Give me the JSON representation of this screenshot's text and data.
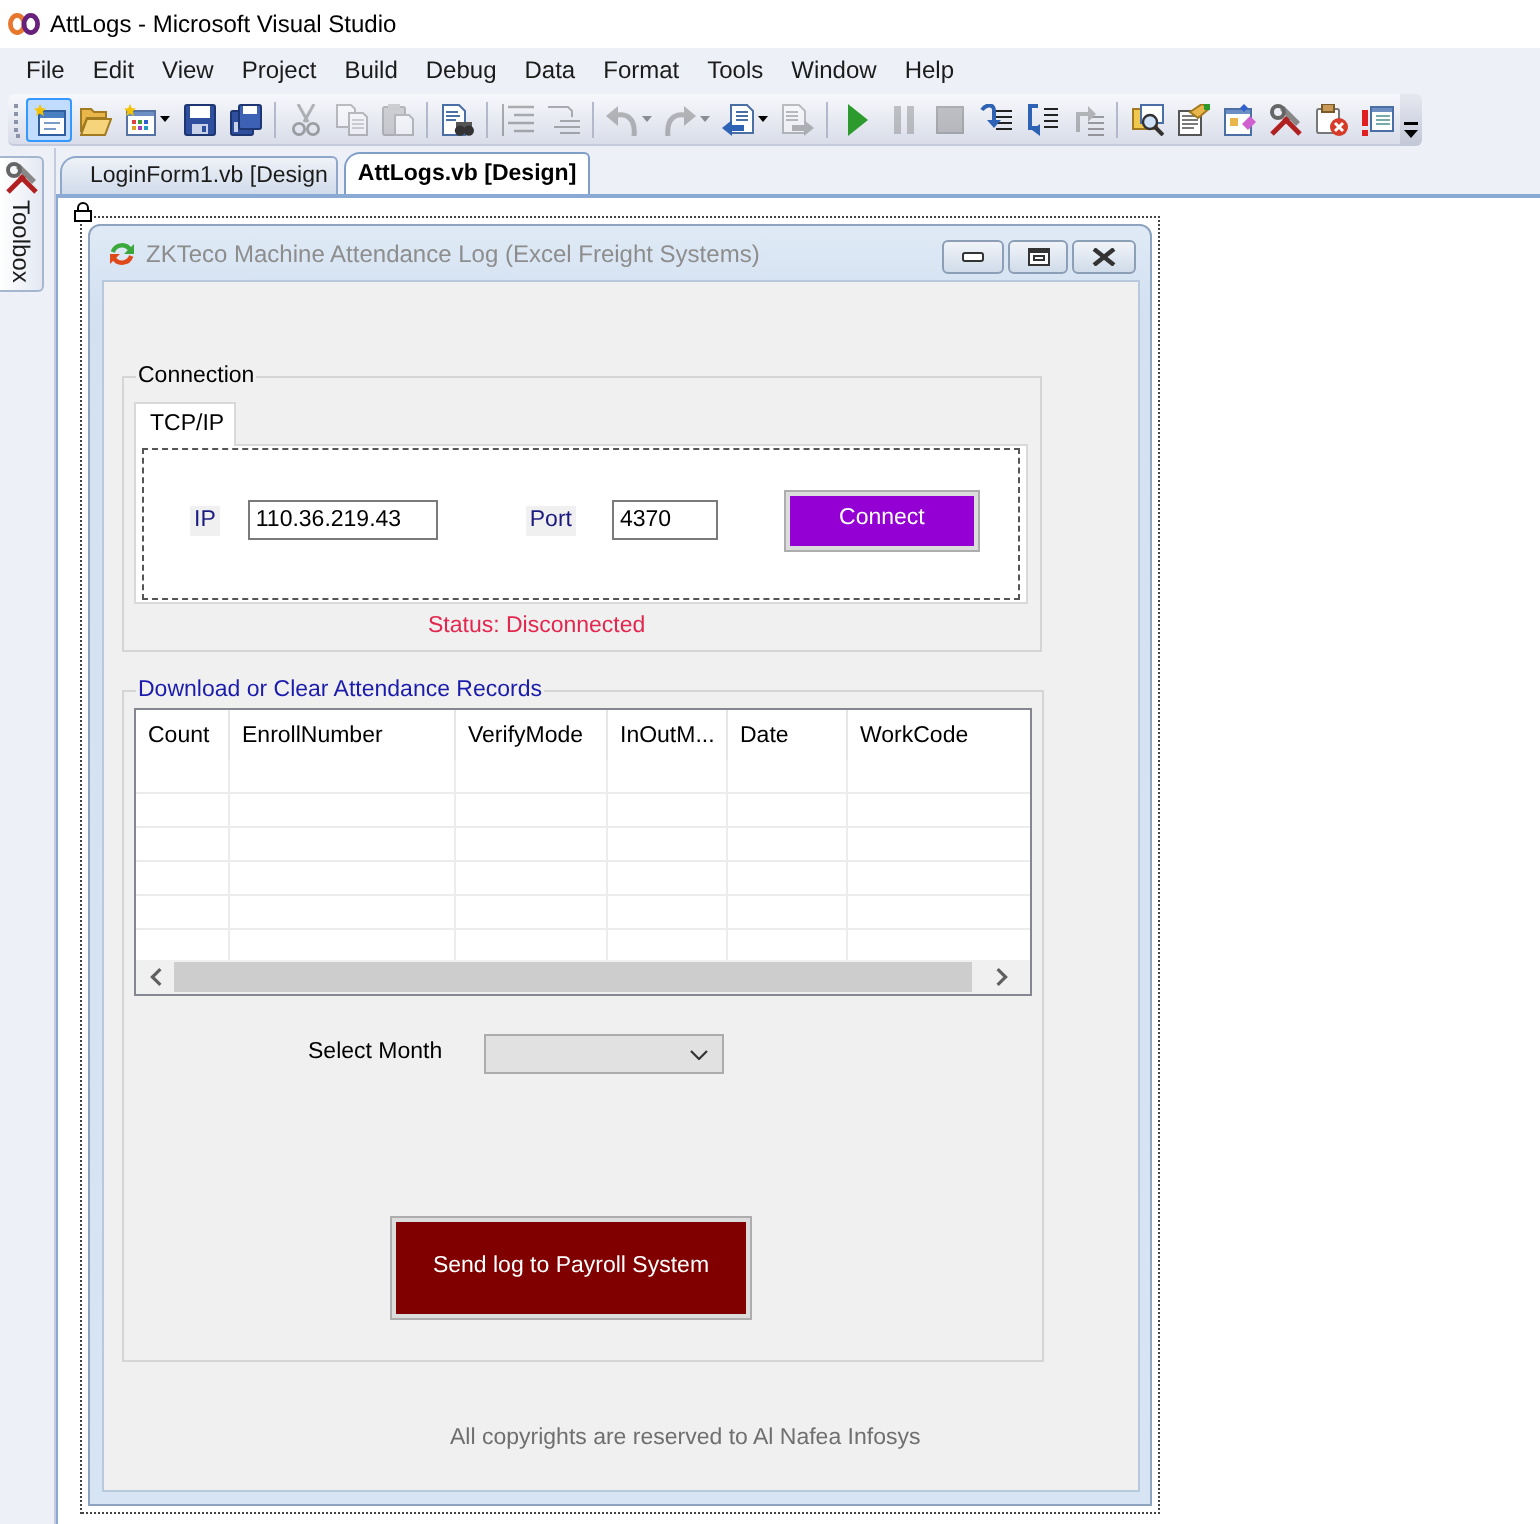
{
  "window": {
    "title": "AttLogs - Microsoft Visual Studio"
  },
  "menu": [
    "File",
    "Edit",
    "View",
    "Project",
    "Build",
    "Debug",
    "Data",
    "Format",
    "Tools",
    "Window",
    "Help"
  ],
  "toolbar": [
    [
      {
        "disabled": false,
        "highlighted": true,
        "dropdown": false
      },
      {
        "disabled": false,
        "highlighted": false,
        "dropdown": false
      },
      {
        "disabled": false,
        "highlighted": false,
        "dropdown": true
      },
      {
        "disabled": false,
        "highlighted": false,
        "dropdown": false
      },
      {
        "disabled": false,
        "highlighted": false,
        "dropdown": false
      }
    ],
    [
      {
        "disabled": true,
        "highlighted": false,
        "dropdown": false
      },
      {
        "disabled": true,
        "highlighted": false,
        "dropdown": false
      },
      {
        "disabled": true,
        "highlighted": false,
        "dropdown": false
      }
    ],
    [
      {
        "disabled": false,
        "highlighted": false,
        "dropdown": false
      }
    ],
    [
      {
        "disabled": true,
        "highlighted": false,
        "dropdown": false
      },
      {
        "disabled": true,
        "highlighted": false,
        "dropdown": false
      }
    ],
    [
      {
        "disabled": true,
        "highlighted": false,
        "dropdown": true
      },
      {
        "disabled": true,
        "highlighted": false,
        "dropdown": true
      },
      {
        "disabled": false,
        "highlighted": false,
        "dropdown": true
      },
      {
        "disabled": true,
        "highlighted": false,
        "dropdown": false
      }
    ],
    [
      {
        "disabled": false,
        "highlighted": false,
        "dropdown": false
      },
      {
        "disabled": true,
        "highlighted": false,
        "dropdown": false
      },
      {
        "disabled": true,
        "highlighted": false,
        "dropdown": false
      },
      {
        "disabled": false,
        "highlighted": false,
        "dropdown": false
      },
      {
        "disabled": false,
        "highlighted": false,
        "dropdown": false
      },
      {
        "disabled": true,
        "highlighted": false,
        "dropdown": false
      }
    ],
    [
      {
        "disabled": false,
        "highlighted": false,
        "dropdown": false
      },
      {
        "disabled": false,
        "highlighted": false,
        "dropdown": false
      },
      {
        "disabled": false,
        "highlighted": false,
        "dropdown": false
      },
      {
        "disabled": false,
        "highlighted": false,
        "dropdown": false
      },
      {
        "disabled": false,
        "highlighted": false,
        "dropdown": false
      },
      {
        "disabled": false,
        "highlighted": false,
        "dropdown": false
      }
    ]
  ],
  "toolbox": {
    "label": "Toolbox"
  },
  "tabs": [
    {
      "label": "LoginForm1.vb [Design",
      "selected": false
    },
    {
      "label": "AttLogs.vb [Design]",
      "selected": true
    }
  ],
  "form": {
    "title": "ZKTeco Machine Attendance Log (Excel Freight Systems)",
    "connection": {
      "legend": "Connection",
      "tabs": [
        {
          "label": "TCP/IP",
          "selected": true
        }
      ],
      "ip_label": "IP",
      "ip": "110.36.219.43",
      "port_label": "Port",
      "port": "4370",
      "connect_button": "Connect",
      "status": "Status: Disconnected"
    },
    "records": {
      "legend": "Download or Clear Attendance Records",
      "columns": [
        "Count",
        "EnrollNumber",
        "VerifyMode",
        "InOutM...",
        "Date",
        "WorkCode"
      ],
      "month_label": "Select Month",
      "send_button": "Send log to Payroll System"
    },
    "footer": "All copyrights are reserved to Al Nafea Infosys"
  }
}
